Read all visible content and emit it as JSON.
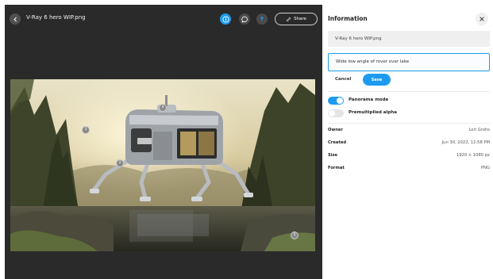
{
  "viewer": {
    "file_title": "V-Ray 6 hero WIP.png",
    "share_label": "Share",
    "icons": {
      "back": "chevron-left-icon",
      "info": "info-icon",
      "comment": "comment-icon",
      "upload": "upload-icon",
      "share": "link-icon"
    },
    "pins": [
      "4",
      "3",
      "2",
      "5"
    ]
  },
  "panel": {
    "title": "Information",
    "name_value": "V-Ray 6 hero WIP.png",
    "description_value": "Wide low angle of rover over lake",
    "cancel_label": "Cancel",
    "save_label": "Save",
    "toggles": [
      {
        "label": "Panorama mode",
        "on": true
      },
      {
        "label": "Premultiplied alpha",
        "on": false
      }
    ],
    "meta": [
      {
        "key": "Owner",
        "value": "Lori Grohs"
      },
      {
        "key": "Created",
        "value": "Jun 30, 2022, 12:58 PM"
      },
      {
        "key": "Size",
        "value": "1920 × 1080 px"
      },
      {
        "key": "Format",
        "value": "PNG"
      }
    ]
  },
  "colors": {
    "accent": "#1c9bf0",
    "viewer_bg": "#2a2a2a",
    "panel_bg": "#ffffff"
  }
}
